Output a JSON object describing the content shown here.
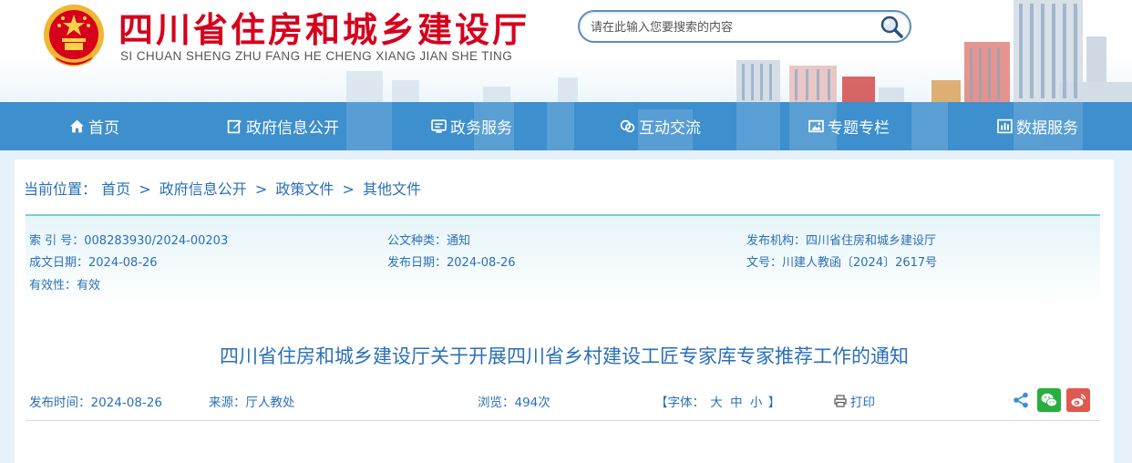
{
  "header": {
    "title": "四川省住房和城乡建设厅",
    "subtitle": "SI CHUAN SHENG ZHU FANG HE CHENG XIANG JIAN SHE TING"
  },
  "search": {
    "placeholder": "请在此输入您要搜索的内容"
  },
  "nav": {
    "items": [
      {
        "label": "首页",
        "icon": "home-icon"
      },
      {
        "label": "政府信息公开",
        "icon": "edit-icon"
      },
      {
        "label": "政务服务",
        "icon": "monitor-icon"
      },
      {
        "label": "互动交流",
        "icon": "chat-icon"
      },
      {
        "label": "专题专栏",
        "icon": "image-icon"
      },
      {
        "label": "数据服务",
        "icon": "chart-icon"
      }
    ]
  },
  "breadcrumb": {
    "prefix": "当前位置：",
    "items": [
      "首页",
      "政府信息公开",
      "政策文件",
      "其他文件"
    ],
    "separator": ">"
  },
  "meta": {
    "index_no": "索 引 号：008283930/2024-00203",
    "doc_type": "公文种类：通知",
    "publisher": "发布机构：四川省住房和城乡建设厅",
    "created_date": "成文日期：2024-08-26",
    "publish_date": "发布日期：2024-08-26",
    "doc_no": "文号：川建人教函〔2024〕2617号",
    "validity": "有效性：有效"
  },
  "document": {
    "title": "四川省住房和城乡建设厅关于开展四川省乡村建设工匠专家库专家推荐工作的通知"
  },
  "info": {
    "publish_time": "发布时间：2024-08-26",
    "source": "来源：厅人教处",
    "views": "浏览：494次",
    "font_label": "【字体：",
    "font_large": "大",
    "font_medium": "中",
    "font_small": "小",
    "font_close": "】",
    "print": "打印"
  },
  "colors": {
    "brand_red": "#d6001c",
    "nav_blue": "#3d8fcd",
    "link_blue": "#2a6fb8",
    "wechat_green": "#2aae3f",
    "weibo_red": "#e0584f"
  }
}
